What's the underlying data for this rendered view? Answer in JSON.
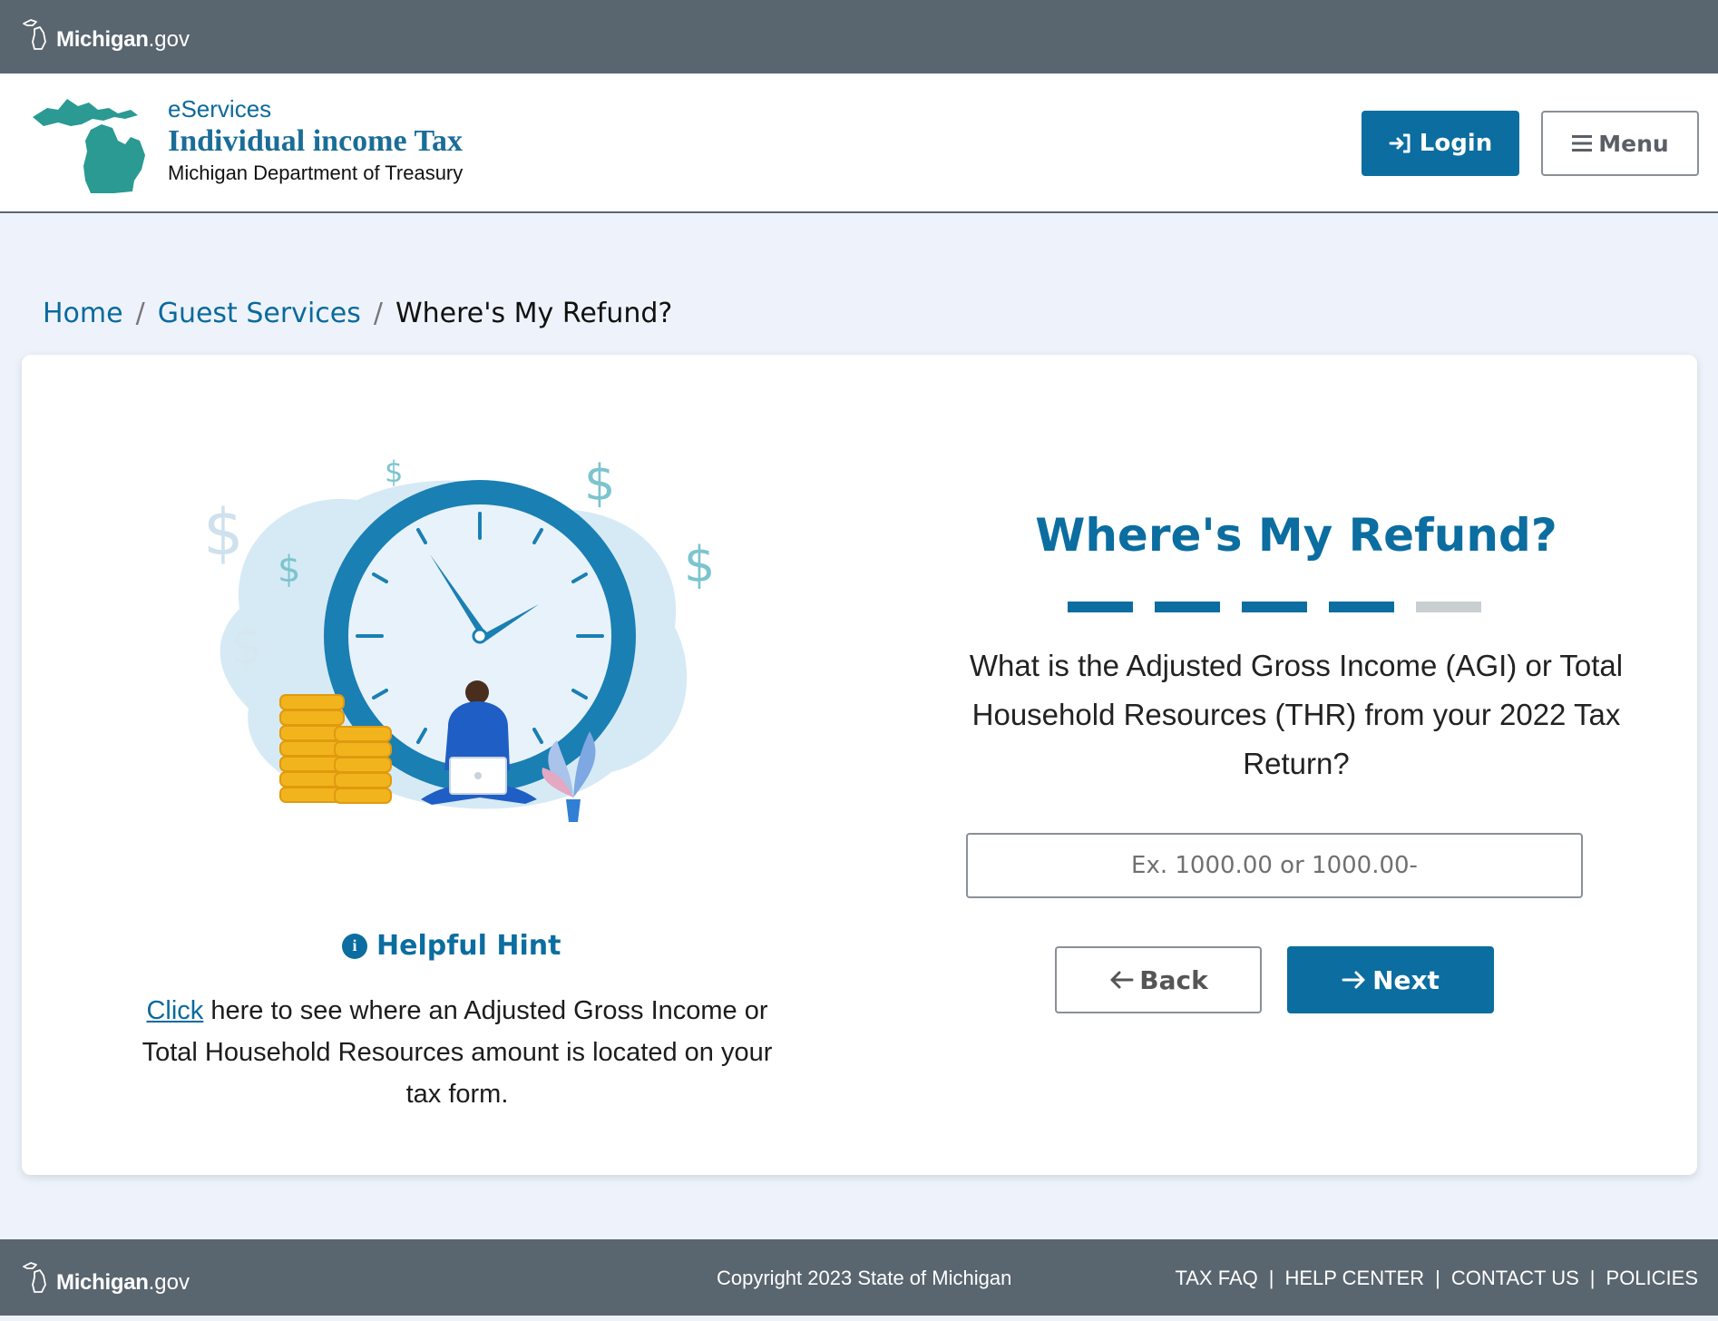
{
  "topbar": {
    "logo_name": "Michigan",
    "logo_tld": ".gov"
  },
  "header": {
    "eservices": "eServices",
    "product": "Individual income Tax",
    "department": "Michigan Department of Treasury",
    "login_label": "Login",
    "menu_label": "Menu"
  },
  "breadcrumb": {
    "home": "Home",
    "guest": "Guest Services",
    "current": "Where's My Refund?",
    "separator": "/"
  },
  "hint": {
    "title": "Helpful Hint",
    "icon_glyph": "i",
    "link_text": "Click",
    "text": " here to see where an Adjusted Gross Income or Total Household Resources amount is located on your tax form."
  },
  "main": {
    "heading": "Where's My Refund?",
    "progress": {
      "completed": 4,
      "total": 5
    },
    "question": "What is the Adjusted Gross Income (AGI) or Total Household Resources (THR) from your 2022 Tax Return?",
    "input_placeholder": "Ex. 1000.00 or 1000.00-",
    "input_value": "",
    "back_label": "Back",
    "next_label": "Next"
  },
  "footer": {
    "logo_name": "Michigan",
    "logo_tld": ".gov",
    "copyright": "Copyright 2023 State of Michigan",
    "links": [
      "TAX FAQ",
      "HELP CENTER",
      "CONTACT US",
      "POLICIES"
    ],
    "separator": "|"
  },
  "colors": {
    "brand_blue": "#0b6da0",
    "bar_gray": "#59656f",
    "page_bg": "#eef3fb",
    "map_teal": "#2a9a93"
  },
  "icons": [
    "michigan-outline-icon",
    "michigan-map-icon",
    "login-icon",
    "menu-icon",
    "info-icon",
    "arrow-left-icon",
    "arrow-right-icon"
  ]
}
